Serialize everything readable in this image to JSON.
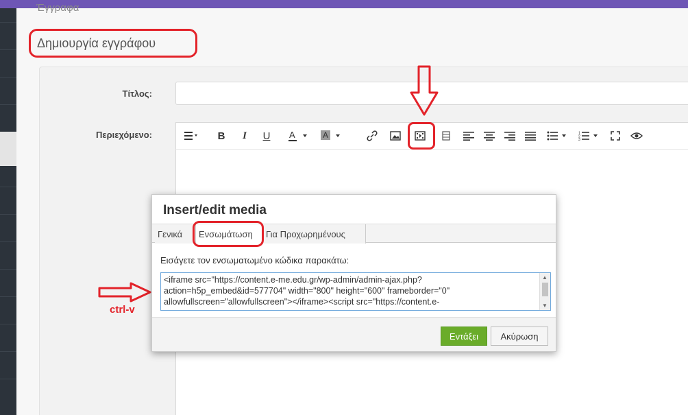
{
  "breadcrumb": "Έγγραφα",
  "page_title": "Δημιουργία εγγράφου",
  "form": {
    "title_label": "Τίτλος:",
    "content_label": "Περιεχόμενο:"
  },
  "toolbar": {
    "buttons": [
      "≡▾",
      "B",
      "I",
      "U",
      "A ▾",
      "A ▾",
      "🔗",
      "▣",
      "▣",
      "▤",
      "≣",
      "≣",
      "≣",
      "≣",
      "☰ ▾",
      "☰ ▾",
      "⛶",
      "👁"
    ]
  },
  "modal": {
    "title": "Insert/edit media",
    "tabs": [
      "Γενικά",
      "Ενσωμάτωση",
      "Για Προχωρημένους"
    ],
    "active_tab": "Ενσωμάτωση",
    "instruction": "Εισάγετε τον ενσωματωμένο κώδικα παρακάτω:",
    "code_lines": [
      "<iframe src=\"https://content.e-me.edu.gr/wp-admin/admin-ajax.php?",
      "action=h5p_embed&id=577704\" width=\"800\" height=\"600\" frameborder=\"0\"",
      "allowfullscreen=\"allowfullscreen\"></iframe><script src=\"https://content.e-"
    ],
    "ok_label": "Εντάξει",
    "cancel_label": "Ακύρωση"
  },
  "annotation": {
    "ctrlv": "ctrl-v"
  },
  "colors": {
    "accent_purple": "#6e56b5",
    "annotation_red": "#e3232a",
    "ok_green": "#6aac2a"
  }
}
